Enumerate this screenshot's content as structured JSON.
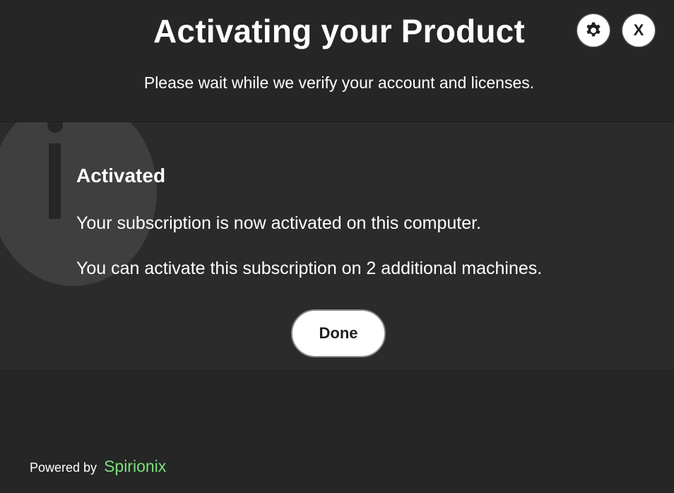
{
  "header": {
    "title": "Activating your Product",
    "subtitle": "Please wait while we verify your account and licenses."
  },
  "controls": {
    "settings_icon": "gear-icon",
    "close_label": "X"
  },
  "panel": {
    "icon": "info-icon",
    "heading": "Activated",
    "lines": [
      "Your subscription is now activated on this computer.",
      "You can activate this subscription on 2 additional machines."
    ],
    "done_label": "Done"
  },
  "footer": {
    "powered_by": "Powered by",
    "brand": "Spirionix"
  },
  "colors": {
    "background": "#262626",
    "panel": "#2b2b2b",
    "brand_accent": "#7be07d",
    "button": "#ffffff"
  }
}
